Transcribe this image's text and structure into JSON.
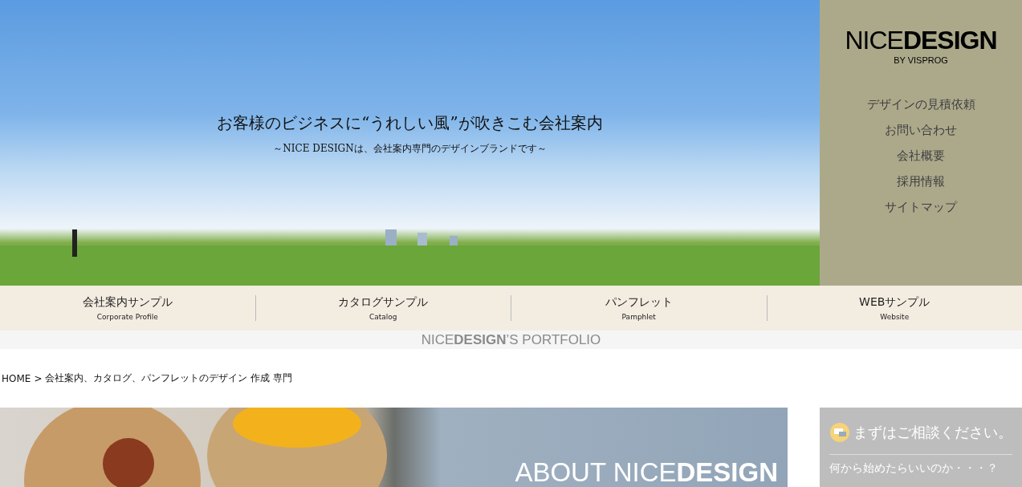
{
  "hero": {
    "headline": "お客様のビジネスに“うれしい風”が吹きこむ会社案内",
    "subline": "～NICE DESIGNは、会社案内専門のデザインブランドです～"
  },
  "sidebar": {
    "logo": "NICE**DESIGN**",
    "logo_sub": "BY VISPROG",
    "links": [
      "デザインの見積依頼",
      "お問い合わせ",
      "会社概要",
      "採用情報",
      "サイトマップ"
    ]
  },
  "nav": [
    {
      "label": "会社案内サンプル",
      "sub": "Corporate Profile"
    },
    {
      "label": "カタログサンプル",
      "sub": "Catalog"
    },
    {
      "label": "パンフレット",
      "sub": "Pamphlet"
    },
    {
      "label": "WEBサンプル",
      "sub": "Website"
    }
  ],
  "portfolio_title": "NICE**DESIGN**’S PORTFOLIO",
  "breadcrumb": {
    "home": "HOME",
    "separator": ">",
    "current": "会社案内、カタログ、パンフレットのデザイン 作成 専門"
  },
  "about_banner": {
    "title": "ABOUT NICE**DESIGN**"
  },
  "consult": {
    "title": "まずはご相談ください。",
    "lead": "何から始めたらいいのか・・・？"
  }
}
